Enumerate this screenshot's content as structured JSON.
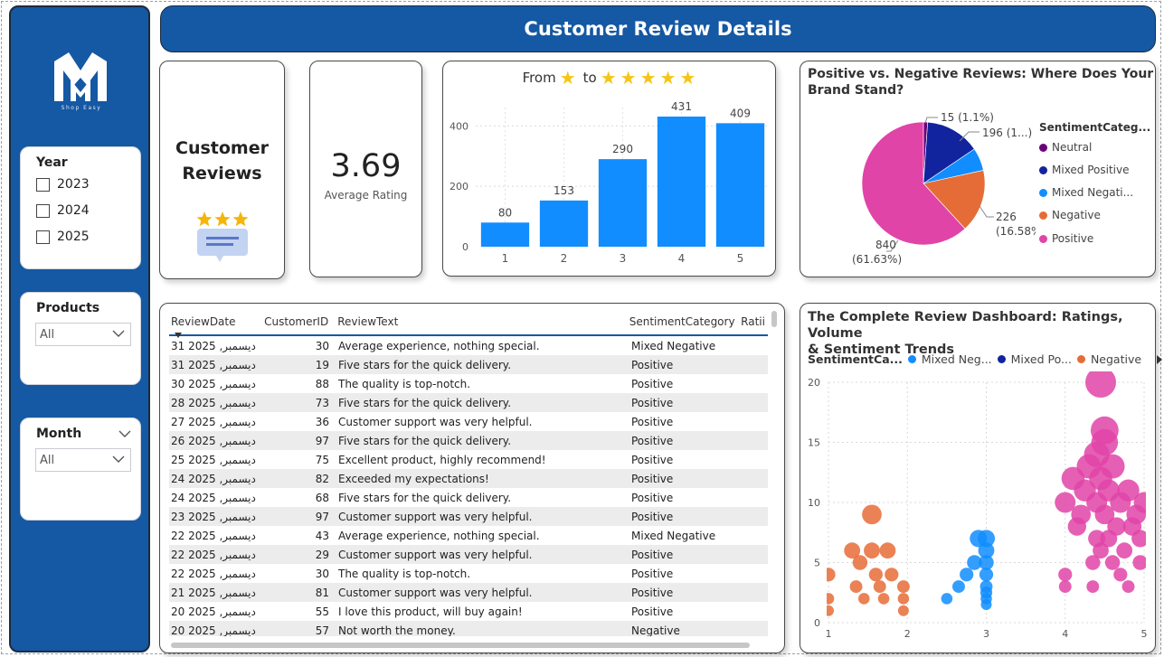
{
  "header": {
    "title": "Customer Review Details"
  },
  "brand": {
    "tagline": "Shop Easy"
  },
  "filters": {
    "year": {
      "title": "Year",
      "options": [
        "2023",
        "2024",
        "2025"
      ]
    },
    "products": {
      "title": "Products",
      "value": "All"
    },
    "month": {
      "title": "Month",
      "value": "All"
    }
  },
  "cards": {
    "reviews_title_line1": "Customer",
    "reviews_title_line2": "Reviews",
    "average_rating": "3.69",
    "average_rating_label": "Average Rating"
  },
  "bar_chart": {
    "title_from": "From",
    "title_to": "to",
    "star_glyph": "★"
  },
  "pie_chart": {
    "title_line1": "Positive vs. Negative Reviews: Where Does Your",
    "title_line2": "Brand Stand?",
    "legend_title": "SentimentCateg...",
    "legend": [
      "Neutral",
      "Mixed Positive",
      "Mixed Negati...",
      "Negative",
      "Positive"
    ],
    "labels": {
      "neutral": "15 (1.1%)",
      "mixed_positive": "196 (1...)",
      "negative_value": "226",
      "negative_pct": "(16.58%)",
      "positive_value": "840",
      "positive_pct": "(61.63%)"
    }
  },
  "table": {
    "columns": [
      "ReviewDate",
      "CustomerID",
      "ReviewText",
      "SentimentCategory",
      "Ratii"
    ],
    "rows": [
      [
        "31 2025 ,دیسمبر",
        "30",
        "Average experience, nothing special.",
        "Mixed Negative"
      ],
      [
        "31 2025 ,دیسمبر",
        "19",
        "Five stars for the quick delivery.",
        "Positive"
      ],
      [
        "30 2025 ,دیسمبر",
        "88",
        "The quality is top-notch.",
        "Positive"
      ],
      [
        "28 2025 ,دیسمبر",
        "73",
        "Five stars for the quick delivery.",
        "Positive"
      ],
      [
        "27 2025 ,دیسمبر",
        "36",
        "Customer support was very helpful.",
        "Positive"
      ],
      [
        "26 2025 ,دیسمبر",
        "97",
        "Five stars for the quick delivery.",
        "Positive"
      ],
      [
        "25 2025 ,دیسمبر",
        "75",
        "Excellent product, highly recommend!",
        "Positive"
      ],
      [
        "24 2025 ,دیسمبر",
        "82",
        "Exceeded my expectations!",
        "Positive"
      ],
      [
        "24 2025 ,دیسمبر",
        "68",
        "Five stars for the quick delivery.",
        "Positive"
      ],
      [
        "23 2025 ,دیسمبر",
        "97",
        "Customer support was very helpful.",
        "Positive"
      ],
      [
        "22 2025 ,دیسمبر",
        "43",
        "Average experience, nothing special.",
        "Mixed Negative"
      ],
      [
        "22 2025 ,دیسمبر",
        "29",
        "Customer support was very helpful.",
        "Positive"
      ],
      [
        "22 2025 ,دیسمبر",
        "30",
        "The quality is top-notch.",
        "Positive"
      ],
      [
        "21 2025 ,دیسمبر",
        "81",
        "Customer support was very helpful.",
        "Positive"
      ],
      [
        "20 2025 ,دیسمبر",
        "55",
        "I love this product, will buy again!",
        "Positive"
      ],
      [
        "20 2025 ,دیسمبر",
        "57",
        "Not worth the money.",
        "Negative"
      ]
    ]
  },
  "scatter_chart": {
    "title_line1": "The Complete Review Dashboard: Ratings, Volume",
    "title_line2": "& Sentiment Trends",
    "legend_title": "SentimentCa...",
    "legend": [
      "Mixed Neg...",
      "Mixed Po...",
      "Negative"
    ]
  },
  "colors": {
    "brand_blue": "#1558a3",
    "bar_blue": "#118dff",
    "neutral": "#6b007b",
    "mixed_positive": "#12239e",
    "mixed_negative": "#118dff",
    "negative": "#e66c37",
    "positive": "#e044a7"
  },
  "chart_data": [
    {
      "type": "bar",
      "categories": [
        "1",
        "2",
        "3",
        "4",
        "5"
      ],
      "values": [
        80,
        153,
        290,
        431,
        409
      ],
      "ylim": [
        0,
        431
      ],
      "yticks": [
        0,
        200,
        400
      ],
      "grid": true
    },
    {
      "type": "pie",
      "categories": [
        "Neutral",
        "Mixed Positive",
        "Mixed Negative",
        "Negative",
        "Positive"
      ],
      "values": [
        15,
        196,
        82,
        226,
        840
      ]
    },
    {
      "type": "scatter",
      "xlim": [
        1,
        5
      ],
      "ylim": [
        0,
        20
      ],
      "xticks": [
        1,
        2,
        3,
        4,
        5
      ],
      "yticks": [
        0,
        5,
        10,
        15,
        20
      ],
      "grid": true,
      "series": [
        {
          "name": "Negative",
          "points": [
            [
              1.0,
              4
            ],
            [
              1.0,
              2
            ],
            [
              1.0,
              1
            ],
            [
              1.3,
              6
            ],
            [
              1.4,
              5
            ],
            [
              1.35,
              3
            ],
            [
              1.45,
              2
            ],
            [
              1.55,
              6
            ],
            [
              1.6,
              4
            ],
            [
              1.55,
              9
            ],
            [
              1.65,
              3
            ],
            [
              1.7,
              2
            ],
            [
              1.75,
              6
            ],
            [
              1.8,
              4
            ],
            [
              1.95,
              3
            ],
            [
              1.95,
              2
            ],
            [
              1.95,
              1
            ]
          ]
        },
        {
          "name": "Mixed Negative",
          "points": [
            [
              2.5,
              2
            ],
            [
              2.65,
              3
            ],
            [
              2.75,
              4
            ],
            [
              2.85,
              5
            ],
            [
              2.9,
              7
            ],
            [
              3.0,
              7
            ],
            [
              3.0,
              6
            ],
            [
              3.0,
              5
            ],
            [
              3.0,
              4
            ],
            [
              3.0,
              3
            ],
            [
              3.0,
              2.5
            ],
            [
              3.0,
              2
            ],
            [
              3.0,
              1.5
            ]
          ]
        },
        {
          "name": "Positive",
          "points": [
            [
              4.0,
              4
            ],
            [
              4.0,
              3
            ],
            [
              4.0,
              10
            ],
            [
              4.1,
              12
            ],
            [
              4.15,
              8
            ],
            [
              4.2,
              9
            ],
            [
              4.25,
              11
            ],
            [
              4.3,
              13
            ],
            [
              4.35,
              5
            ],
            [
              4.35,
              3
            ],
            [
              4.4,
              7
            ],
            [
              4.4,
              10
            ],
            [
              4.4,
              14
            ],
            [
              4.45,
              6
            ],
            [
              4.45,
              12
            ],
            [
              4.45,
              20
            ],
            [
              4.5,
              15
            ],
            [
              4.5,
              16
            ],
            [
              4.5,
              9
            ],
            [
              4.55,
              11
            ],
            [
              4.55,
              7
            ],
            [
              4.6,
              13
            ],
            [
              4.6,
              5
            ],
            [
              4.65,
              8
            ],
            [
              4.7,
              10
            ],
            [
              4.7,
              4
            ],
            [
              4.75,
              6
            ],
            [
              4.8,
              11
            ],
            [
              4.8,
              3
            ],
            [
              4.85,
              8
            ],
            [
              4.9,
              9
            ],
            [
              4.95,
              5
            ],
            [
              4.95,
              7
            ],
            [
              5.0,
              10
            ]
          ]
        }
      ]
    }
  ]
}
